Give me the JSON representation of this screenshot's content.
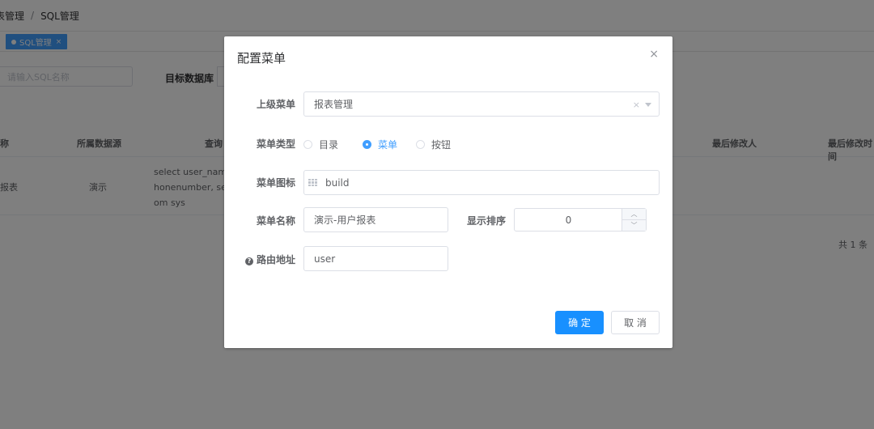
{
  "breadcrumb": {
    "parent": "表管理",
    "separator": "/",
    "current": "SQL管理"
  },
  "tags": [
    {
      "label": "SQL管理",
      "close": "×"
    }
  ],
  "search": {
    "placeholder": "请输入SQL名称",
    "target_label": "目标数据库"
  },
  "table": {
    "headers": [
      "称",
      "所属数据源",
      "查询",
      "最后修改人",
      "最后修改时间"
    ],
    "row": {
      "name": "报表",
      "datasource": "演示",
      "sql": "select user_name\nhonenumber, sex\nom sys"
    },
    "total": "共 1 条"
  },
  "dialog": {
    "title": "配置菜单",
    "close": "×",
    "parent_menu": {
      "label": "上级菜单",
      "value": "报表管理",
      "clear": "×"
    },
    "menu_type": {
      "label": "菜单类型",
      "options": [
        "目录",
        "菜单",
        "按钮"
      ],
      "selected": "菜单"
    },
    "menu_icon": {
      "label": "菜单图标",
      "value": "build"
    },
    "menu_name": {
      "label": "菜单名称",
      "value": "演示-用户报表"
    },
    "sort_order": {
      "label": "显示排序",
      "value": "0"
    },
    "route": {
      "label": "路由地址",
      "value": "user",
      "help": "?"
    },
    "confirm": "确 定",
    "cancel": "取 消"
  },
  "colors": {
    "primary": "#1890ff",
    "overlay": "rgba(0,0,0,0.5)"
  }
}
